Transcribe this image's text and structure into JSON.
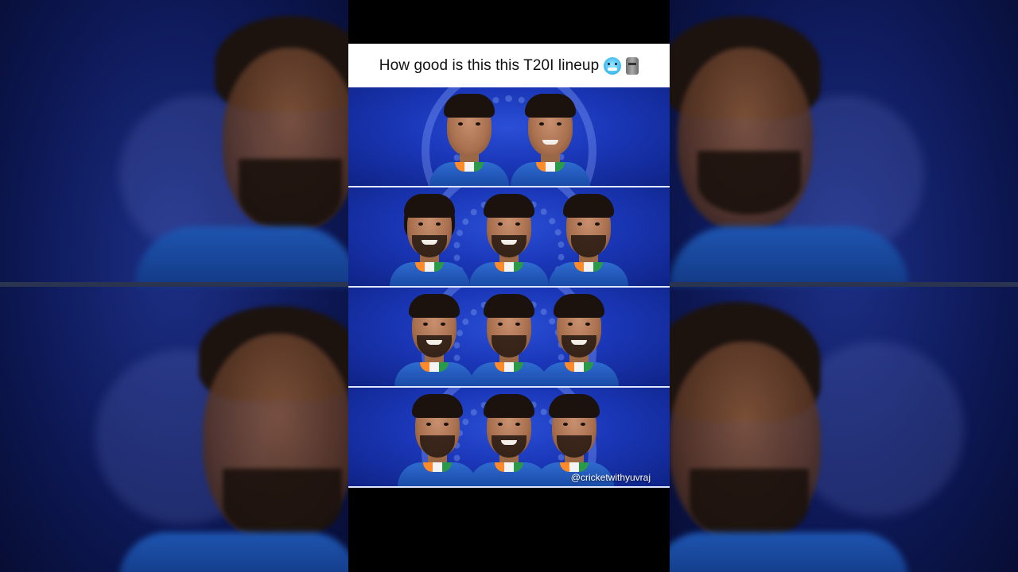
{
  "post": {
    "title": "How good is this this T20I lineup",
    "emoji_1": "cold-face-emoji",
    "emoji_2": "moai-emoji",
    "watermark": "@cricketwithyuvraj"
  },
  "lineup": {
    "rows": [
      {
        "players": 2
      },
      {
        "players": 3
      },
      {
        "players": 3
      },
      {
        "players": 3
      }
    ]
  },
  "colors": {
    "background": "#000000",
    "title_bar": "#ffffff",
    "row_background": "#1a37b8",
    "jersey": "#1a4ba8"
  }
}
